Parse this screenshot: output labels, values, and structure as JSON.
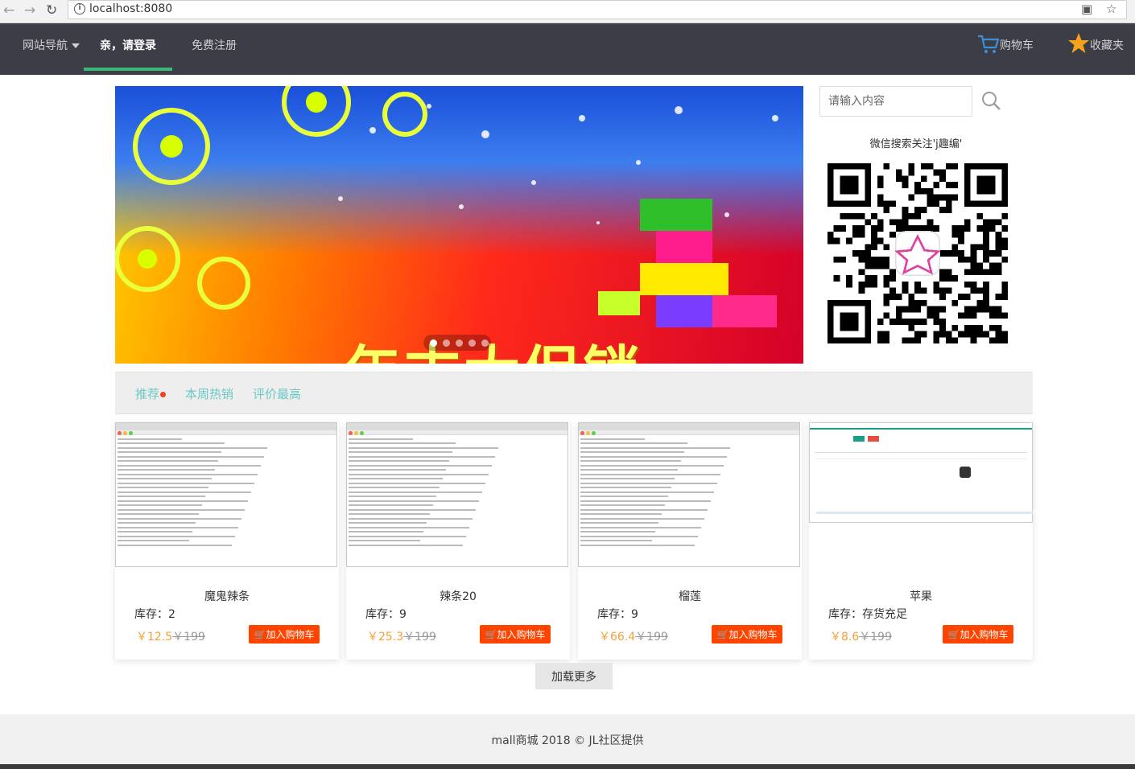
{
  "browser": {
    "url": "localhost:8080"
  },
  "nav": {
    "site_nav": "网站导航",
    "login": "亲，请登录",
    "register": "免费注册",
    "cart": "购物车",
    "favorites": "收藏夹"
  },
  "banner": {
    "text": "年末大促销",
    "slide_count": 5,
    "active_slide": 1
  },
  "search": {
    "placeholder": "请输入内容"
  },
  "wechat": {
    "text": "微信搜索关注'j趣编'"
  },
  "tabs": [
    {
      "label": "推荐"
    },
    {
      "label": "本周热销"
    },
    {
      "label": "评价最高"
    }
  ],
  "products": [
    {
      "name": "魔鬼辣条",
      "stock": "库存：2",
      "price": "￥12.5",
      "old_price": "￥199",
      "button": "加入购物车"
    },
    {
      "name": "辣条20",
      "stock": "库存：9",
      "price": "￥25.3",
      "old_price": "￥199",
      "button": "加入购物车"
    },
    {
      "name": "榴莲",
      "stock": "库存：9",
      "price": "￥66.4",
      "old_price": "￥199",
      "button": "加入购物车"
    },
    {
      "name": "苹果",
      "stock": "库存：存货充足",
      "price": "￥8.6",
      "old_price": "￥199",
      "button": "加入购物车"
    }
  ],
  "load_more": "加载更多",
  "footer": {
    "text": "mall商城 2018 © JL社区提供"
  },
  "colors": {
    "nav_bg": "#3d3d47",
    "accent_green": "#3cb878",
    "tab_text": "#6ac9c3",
    "price": "#f4a13a",
    "cart_button": "#ff4400"
  }
}
